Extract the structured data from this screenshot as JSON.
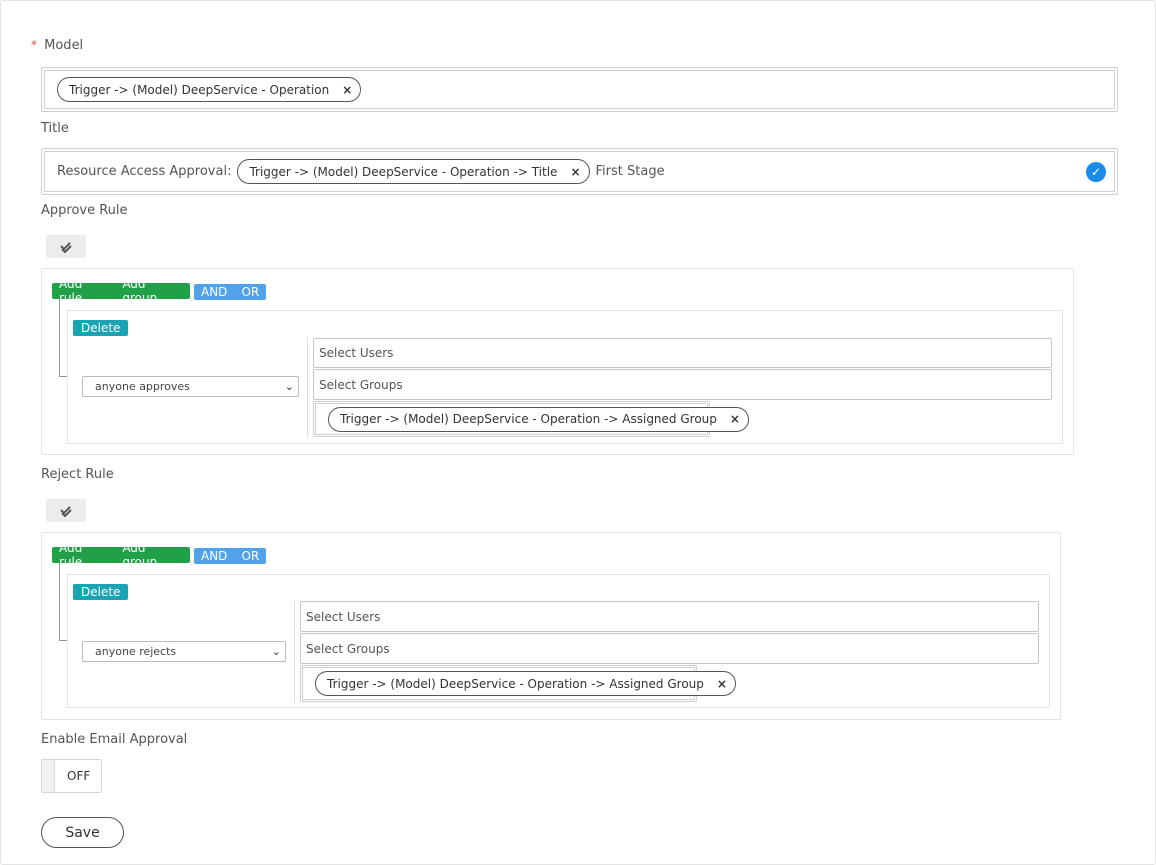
{
  "model": {
    "required_mark": "*",
    "label": "Model",
    "tags": [
      {
        "text": "Trigger -> (Model) DeepService - Operation",
        "remove": "×"
      }
    ]
  },
  "title": {
    "label": "Title",
    "prefix": "Resource Access Approval:",
    "tag": {
      "text": "Trigger -> (Model) DeepService - Operation -> Title",
      "remove": "×"
    },
    "suffix": "First Stage",
    "valid_icon": "check-circle-icon"
  },
  "approve_rule": {
    "label": "Approve Rule",
    "add_rule": "Add rule",
    "add_group": "Add group",
    "and": "AND",
    "or": "OR",
    "delete": "Delete",
    "condition": "anyone approves",
    "users_placeholder": "Select Users",
    "groups_placeholder": "Select Groups",
    "tag": {
      "text": "Trigger -> (Model) DeepService - Operation -> Assigned Group",
      "remove": "×"
    }
  },
  "reject_rule": {
    "label": "Reject Rule",
    "add_rule": "Add rule",
    "add_group": "Add group",
    "and": "AND",
    "or": "OR",
    "delete": "Delete",
    "condition": "anyone rejects",
    "users_placeholder": "Select Users",
    "groups_placeholder": "Select Groups",
    "tag": {
      "text": "Trigger -> (Model) DeepService - Operation -> Assigned Group",
      "remove": "×"
    }
  },
  "email_approval": {
    "label": "Enable Email Approval",
    "state": "OFF"
  },
  "save_label": "Save",
  "colors": {
    "green": "#21a048",
    "blue": "#52a2ea",
    "teal": "#19a3b3",
    "check": "#1a8be6"
  }
}
